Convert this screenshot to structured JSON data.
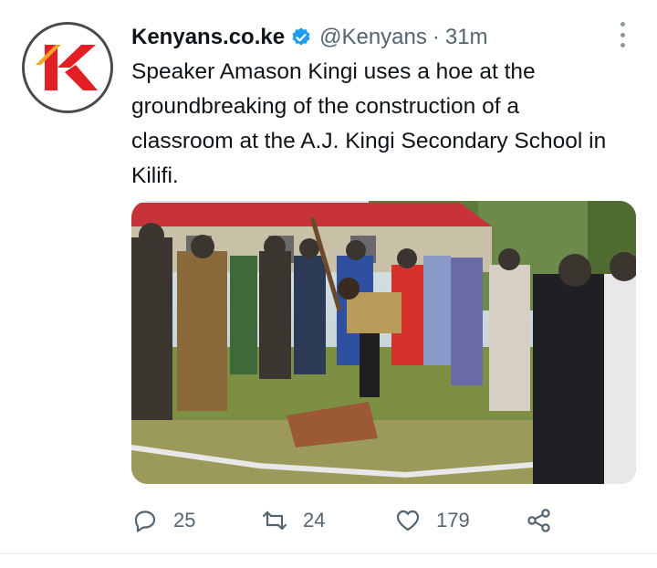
{
  "tweet": {
    "author_name": "Kenyans.co.ke",
    "handle": "@Kenyans",
    "separator": "·",
    "time": "31m",
    "text": "Speaker Amason Kingi uses a hoe at the groundbreaking of the construction of a classroom at the A.J. Kingi Secondary School in Kilifi.",
    "avatar_icon": "kenyans-logo",
    "verified_icon": "verified-badge-icon"
  },
  "media": {
    "description_icon": "photo"
  },
  "actions": {
    "replies": "25",
    "retweets": "24",
    "likes": "179"
  },
  "colors": {
    "accent": "#1d9bf0",
    "logo_red": "#e31e24",
    "muted": "#536471"
  }
}
